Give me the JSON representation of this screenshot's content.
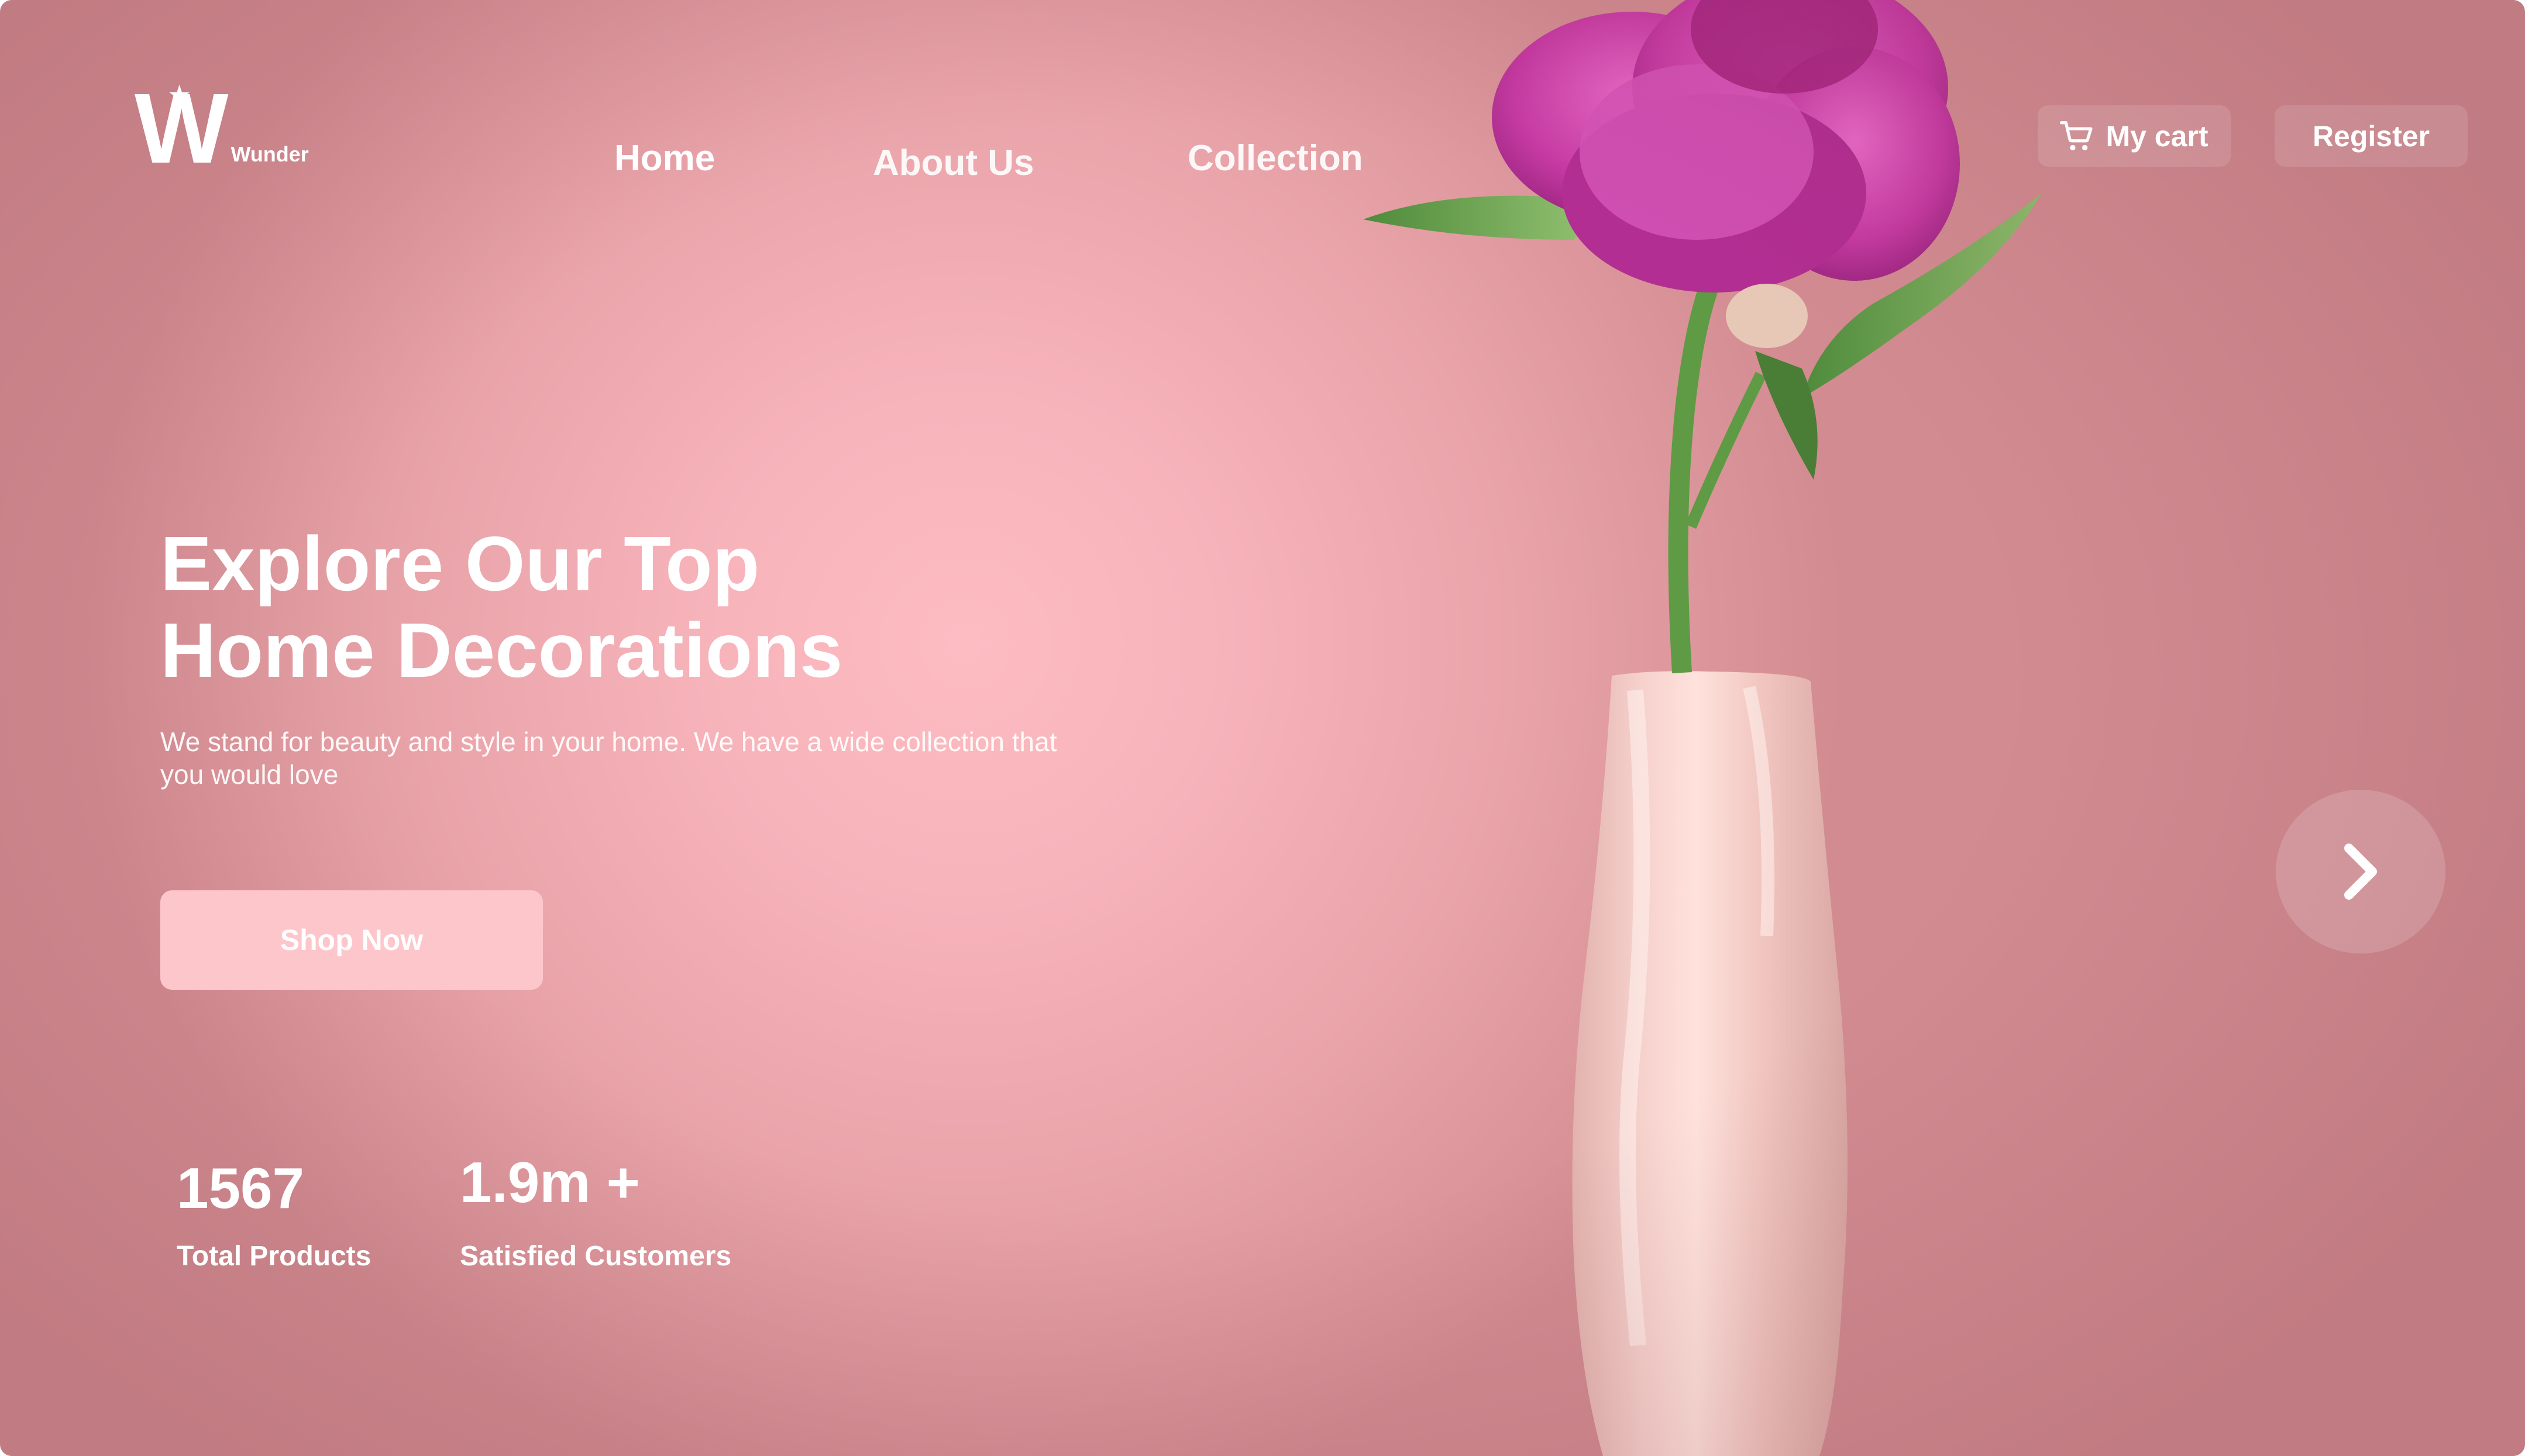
{
  "brand": {
    "logo_letter": "W",
    "logo_text": "Wunder",
    "star": "★"
  },
  "nav": {
    "home": "Home",
    "about": "About Us",
    "collection": "Collection"
  },
  "actions": {
    "cart": "My cart",
    "register": "Register"
  },
  "hero": {
    "title_line1": "Explore Our Top",
    "title_line2": "Home Decorations",
    "subtitle": "We stand for beauty and style in your home. We have a wide collection that you would love",
    "cta": "Shop Now"
  },
  "stats": [
    {
      "value": "1567",
      "label": "Total Products"
    },
    {
      "value": "1.9m +",
      "label": "Satisfied Customers"
    }
  ],
  "icons": {
    "cart": "cart-icon",
    "next": "chevron-right-icon"
  },
  "colors": {
    "background": "#f7b3ba",
    "button": "#fdc6cb",
    "petal": "#c93aa6",
    "vase": "#f2c7c3"
  }
}
